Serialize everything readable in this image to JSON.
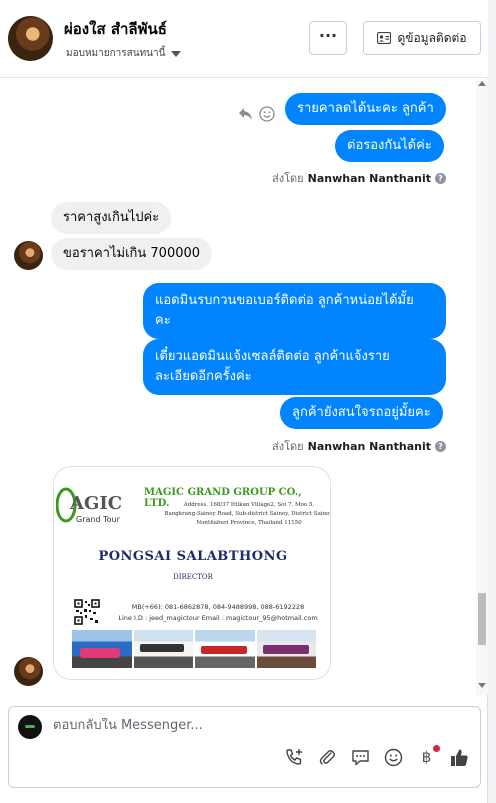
{
  "header": {
    "name": "ผ่องใส สำลีพันธ์",
    "assign_label": "มอบหมายการสนทนานี้",
    "more_label": "···",
    "contact_info_label": "ดูข้อมูลติดต่อ"
  },
  "messages": {
    "out1": "รายคาลดได้นะคะ ลูกค้า",
    "out2": "ต่อรองกันได้ค่ะ",
    "sent_by_prefix": "ส่งโดย",
    "sender": "Nanwhan Nanthanit",
    "in1": "ราคาสูงเกินไปค่ะ",
    "in2": "ขอราคาไม่เกิน 700000",
    "out3_line1": "แอดมินรบกวนขอเบอร์ติดต่อ ลูกค้าหน่อยได้มั้ย",
    "out3_line2": "คะ",
    "out4_line1": "เดี๋ยวแอดมินแจ้งเซลล์ติดต่อ ลูกค้าแจ้งราย",
    "out4_line2": "ละเอียดอีกครั้งค่ะ",
    "out5": "ลูกค้ายังสนใจรถอยู่มั้ยคะ"
  },
  "business_card": {
    "logo_text": "AGIC",
    "logo_sub": "Grand Tour",
    "company": "MAGIC GRAND GROUP CO., LTD.",
    "address_line1": "Address. 168/37 Ittikan Village2, Soi 7, Moo 5,",
    "address_line2": "Bangkrang-Sainoy Road, Sub-district Sainoy, District Sainoy,",
    "address_line3": "Nonthaburi Province, Thailand 11150",
    "person": "PONGSAI SALABTHONG",
    "role": "DIRECTOR",
    "phones": "MB(+66): 081-6862878, 084-9488998, 088-6192228",
    "line_email": "Line I.D : jeed_magictour   Email : magictour_95@hotmail.com"
  },
  "composer": {
    "placeholder": "ตอบกลับใน Messenger..."
  },
  "icons": [
    "chevron-down-icon",
    "address-card-icon",
    "reply-icon",
    "smile-icon",
    "info-icon",
    "phone-add-icon",
    "paperclip-icon",
    "chat-bubble-icon",
    "emoji-icon",
    "baht-icon",
    "thumbs-up-icon"
  ],
  "colors": {
    "outgoing_bubble": "#0084ff",
    "incoming_bubble": "#f0f0f0",
    "link": "#1877f2",
    "notification_dot": "#e41e3f"
  }
}
